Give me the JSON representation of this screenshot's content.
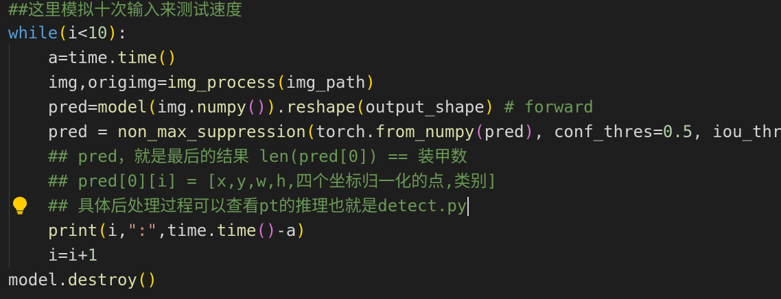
{
  "editor": {
    "language": "python",
    "lines": {
      "l1": "##这里模拟十次输入来测试速度",
      "l2": {
        "kw": "while",
        "open": "(",
        "var": "i<",
        "num": "10",
        "close": ")",
        "colon": ":"
      },
      "l3": {
        "a": "a=time.",
        "fn": "time",
        "open": "(",
        "close": ")"
      },
      "l4": {
        "a": "img,origimg=",
        "fn": "img_process",
        "open": "(",
        "arg": "img_path",
        "close": ")"
      },
      "l5": {
        "a": "pred=",
        "fn": "model",
        "o1": "(",
        "b": "img.",
        "fn2": "numpy",
        "o2": "(",
        "c2": ")",
        "c1": ")",
        "dot": ".",
        "fn3": "reshape",
        "o3": "(",
        "arg": "output_shape",
        "c3": ")",
        "comment": " # forward"
      },
      "l6": {
        "a": "pred = ",
        "fn": "non_max_suppression",
        "o1": "(",
        "b": "torch.",
        "fn2": "from_numpy",
        "o2": "(",
        "arg": "pred",
        "c2": ")",
        "rest": ", conf_thres=",
        "num": "0.5",
        "tail": ", iou_thr"
      },
      "l7": "## pred，就是最后的结果 len(pred[0]) == 装甲数",
      "l8": "## pred[0][i] = [x,y,w,h,四个坐标归一化的点,类别]",
      "l9": "## 具体后处理过程可以查看pt的推理也就是detect.py",
      "l10": {
        "fn": "print",
        "o1": "(",
        "a": "i,",
        "str": "\":\"",
        "b": ",time.",
        "fn2": "time",
        "o2": "(",
        "c2": ")",
        "c": "-a",
        "c1": ")"
      },
      "l11": {
        "a": "i=i+",
        "num": "1"
      },
      "l12": {
        "a": "model.",
        "fn": "destroy",
        "open": "(",
        "close": ")"
      }
    },
    "colors": {
      "background": "#1e1e1e",
      "comment": "#6a9955",
      "keyword": "#569cd6",
      "number": "#b5cea8",
      "string": "#ce9178",
      "function": "#dcdcaa",
      "bracket1": "#ffd700",
      "bracket2": "#da70d6"
    },
    "icons": {
      "lightbulb": "lightbulb-icon"
    }
  }
}
